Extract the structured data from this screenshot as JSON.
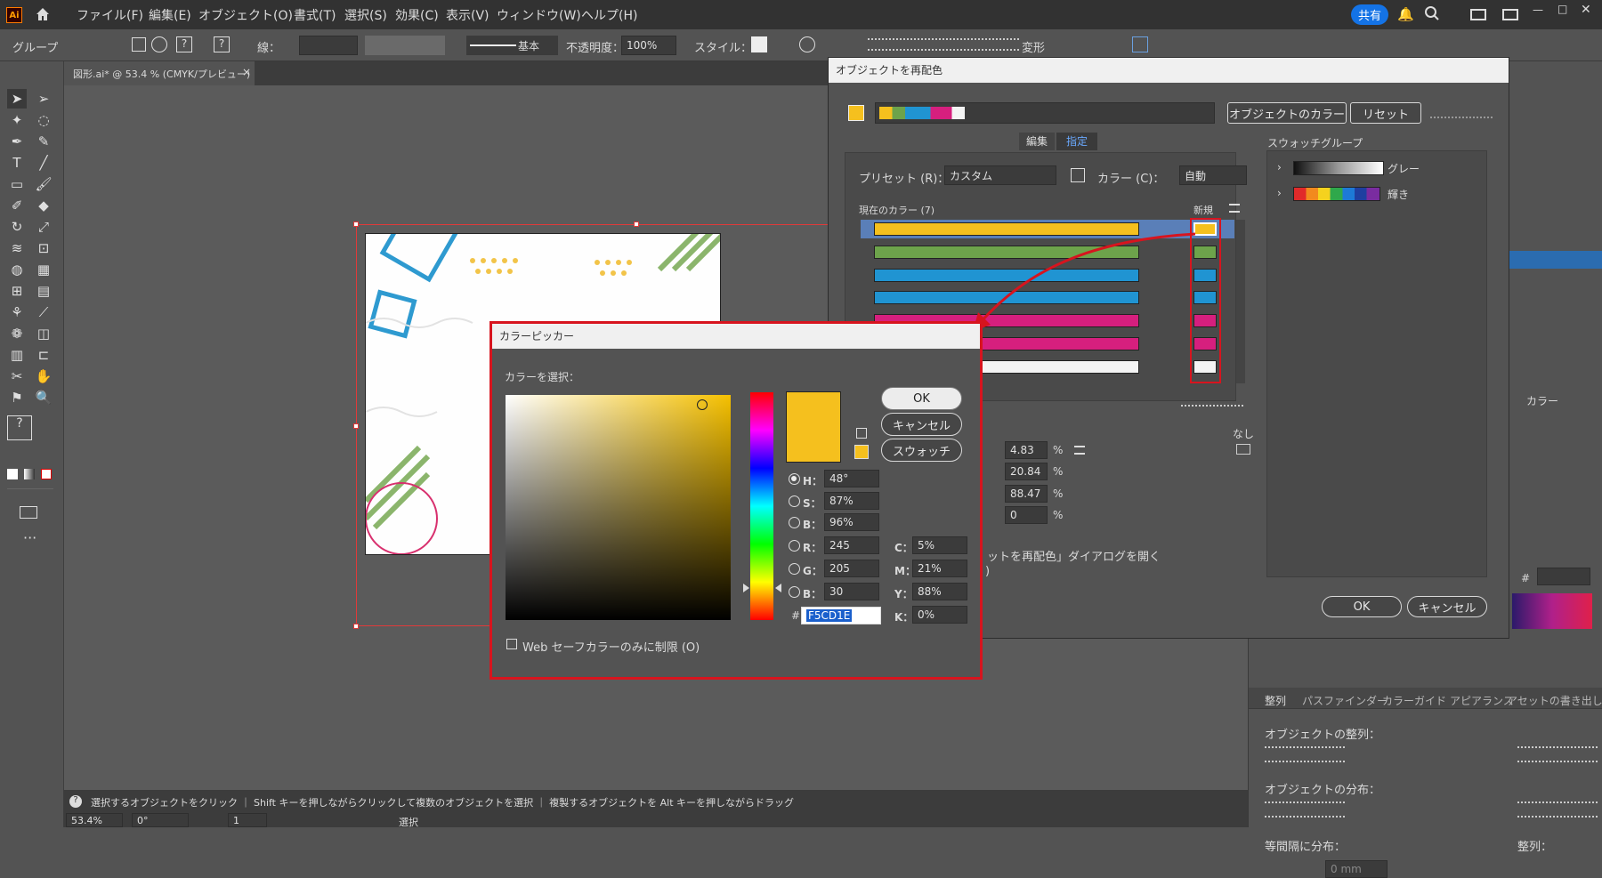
{
  "app": {
    "logo": "Ai",
    "menu": [
      "ファイル(F)",
      "編集(E)",
      "オブジェクト(O)",
      "書式(T)",
      "選択(S)",
      "効果(C)",
      "表示(V)",
      "ウィンドウ(W)",
      "ヘルプ(H)"
    ],
    "share_label": "共有"
  },
  "optionbar": {
    "selection_type": "グループ",
    "stroke_label": "線：",
    "brush_label": "基本",
    "opacity_label": "不透明度：",
    "opacity_value": "100%",
    "style_label": "スタイル：",
    "transform_label": "変形"
  },
  "document_tab": {
    "title": "図形.ai* @ 53.4 % (CMYK/プレビュー)",
    "close": "×"
  },
  "status": {
    "hint": "選択するオブジェクトをクリック ｜ Shift キーを押しながらクリックして複数のオブジェクトを選択 ｜ 複製するオブジェクトを Alt キーを押しながらドラッグ",
    "zoom": "53.4%",
    "rotation": "0°",
    "artboard": "1",
    "mode": "選択"
  },
  "recolor_dialog": {
    "title": "オブジェクトを再配色",
    "object_colors_button": "オブジェクトのカラー",
    "reset_button": "リセット",
    "tab_edit": "編集",
    "tab_assign": "指定",
    "preset_label": "プリセット (R)：",
    "preset_value": "カスタム",
    "colors_label": "カラー (C)：",
    "colors_value": "自動",
    "current_colors_label": "現在のカラー (7)",
    "new_label": "新規",
    "swatch_group_label": "スウォッチグループ",
    "swatch_groups": [
      "グレー",
      "輝き"
    ],
    "none_label": "なし",
    "cmyk_values": [
      "4.83",
      "20.84",
      "88.47",
      "0"
    ],
    "percent": "%",
    "checkbox_text": "ットを再配色」ダイアログを開く",
    "checkbox_text2": ")",
    "ok_button": "OK",
    "cancel_button": "キャンセル",
    "row_colors": [
      "#f5c01e",
      "#6da34b",
      "#2094d2",
      "#2094d2",
      "#d61f7e",
      "#d61f7e",
      "#f4f4f4"
    ]
  },
  "color_picker": {
    "title": "カラーピッカー",
    "prompt": "カラーを選択：",
    "ok_button": "OK",
    "cancel_button": "キャンセル",
    "swatch_button": "スウォッチ",
    "H_label": "H：",
    "H_value": "48°",
    "S_label": "S：",
    "S_value": "87%",
    "B_label": "B：",
    "B_value": "96%",
    "R_label": "R：",
    "R_value": "245",
    "G_label": "G：",
    "G_value": "205",
    "B2_label": "B：",
    "B2_value": "30",
    "C_label": "C：",
    "C_value": "5%",
    "M_label": "M：",
    "M_value": "21%",
    "Y_label": "Y：",
    "Y_value": "88%",
    "K_label": "K：",
    "K_value": "0%",
    "hex_label": "#",
    "hex_value": "F5CD1E",
    "websafe_label": "Web セーフカラーのみに制限 (O)",
    "selected_color": "#f5cd1e"
  },
  "right_panel": {
    "color_tab": "カラー",
    "tabs": [
      "整列",
      "パスファインダー",
      "カラーガイド",
      "アピアランス",
      "アセットの書き出し"
    ],
    "align_objects": "オブジェクトの整列：",
    "distribute_objects": "オブジェクトの分布：",
    "equal_spacing": "等間隔に分布：",
    "align_to": "整列：",
    "spacing_value": "0 mm",
    "hash": "#"
  }
}
